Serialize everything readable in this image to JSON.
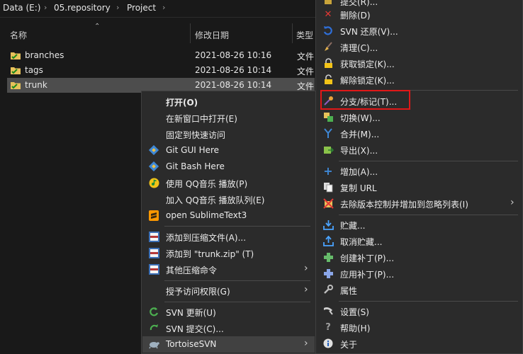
{
  "breadcrumb": {
    "drive": "Data (E:)",
    "folder1": "05.repository",
    "folder2": "Project",
    "sep": "›"
  },
  "columns": {
    "name": "名称",
    "date": "修改日期",
    "type": "类型"
  },
  "files": [
    {
      "name": "branches",
      "date": "2021-08-26 10:16",
      "type": "文件"
    },
    {
      "name": "tags",
      "date": "2021-08-26 10:14",
      "type": "文件"
    },
    {
      "name": "trunk",
      "date": "2021-08-26 10:14",
      "type": "文件"
    }
  ],
  "context_menu": {
    "open": "打开(O)",
    "open_new_window": "在新窗口中打开(E)",
    "pin_quick_access": "固定到快速访问",
    "git_gui": "Git GUI Here",
    "git_bash": "Git Bash Here",
    "qq_play": "使用 QQ音乐 播放(P)",
    "qq_queue": "加入 QQ音乐 播放队列(E)",
    "sublime": "open SublimeText3",
    "add_archive": "添加到压缩文件(A)...",
    "add_zip": "添加到 \"trunk.zip\" (T)",
    "other_compress": "其他压缩命令",
    "grant_access": "授予访问权限(G)",
    "svn_update": "SVN 更新(U)",
    "svn_commit": "SVN 提交(C)...",
    "tortoise": "TortoiseSVN"
  },
  "svn_menu": {
    "cut_off": "提交(R)...",
    "delete": "删除(D)",
    "revert": "SVN 还原(V)...",
    "cleanup": "清理(C)...",
    "get_lock": "获取锁定(K)...",
    "release_lock": "解除锁定(K)...",
    "branch_tag": "分支/标记(T)...",
    "switch": "切换(W)...",
    "merge": "合并(M)...",
    "export": "导出(X)...",
    "add": "增加(A)...",
    "copy_url": "复制 URL",
    "unversion_ignore": "去除版本控制并增加到忽略列表(I)",
    "shelve": "贮藏...",
    "unshelve": "取消贮藏...",
    "create_patch": "创建补丁(P)...",
    "apply_patch": "应用补丁(P)...",
    "properties": "属性",
    "settings": "设置(S)",
    "help": "帮助(H)",
    "about": "关于"
  },
  "colors": {
    "highlight": "#e01818",
    "selected_row": "#4d4d4d",
    "menu_bg": "#2b2b2b"
  }
}
